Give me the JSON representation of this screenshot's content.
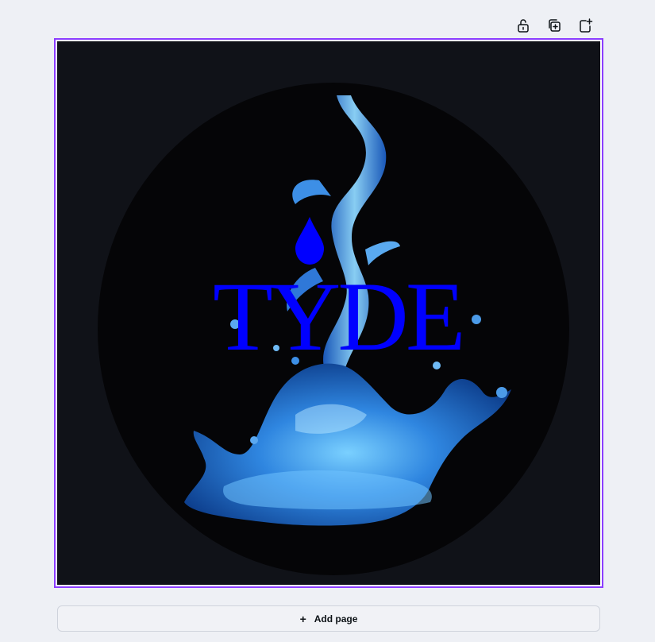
{
  "toolbar": {
    "icons": [
      "unlock-icon",
      "duplicate-page-icon",
      "add-page-icon"
    ]
  },
  "design": {
    "logo_text": "TYDE",
    "logo_color": "#0000ff",
    "background_color": "#101218",
    "circle_color": "#050507"
  },
  "add_page": {
    "label": "Add page",
    "icon": "plus-icon"
  },
  "colors": {
    "selection": "#8b3dff",
    "app_background": "#eef0f5"
  }
}
